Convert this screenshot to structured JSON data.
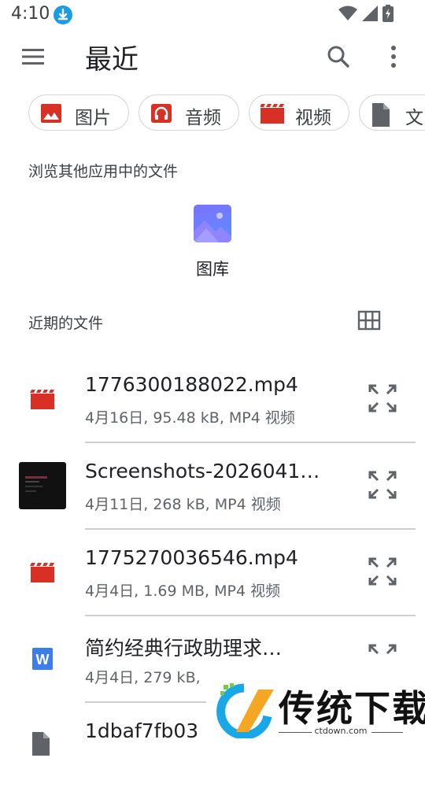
{
  "status_bar": {
    "time": "4:10",
    "icons": [
      "download-icon",
      "wifi-icon",
      "signal-icon",
      "battery-charging-icon"
    ]
  },
  "toolbar": {
    "title": "最近",
    "menu_icon": "hamburger-menu-icon",
    "search_icon": "search-icon",
    "more_icon": "more-vert-icon"
  },
  "chips": [
    {
      "label": "图片",
      "icon": "image-icon",
      "color": "#d93025"
    },
    {
      "label": "音频",
      "icon": "headphones-icon",
      "color": "#d93025"
    },
    {
      "label": "视频",
      "icon": "movie-clapper-icon",
      "color": "#d93025"
    },
    {
      "label": "文",
      "icon": "document-icon",
      "color": "#5f6368"
    }
  ],
  "browse_section": {
    "heading": "浏览其他应用中的文件",
    "apps": [
      {
        "label": "图库",
        "icon": "gallery-icon"
      }
    ]
  },
  "recent_section": {
    "heading": "近期的文件",
    "grid_icon": "grid-view-icon"
  },
  "files": [
    {
      "name": "1776300188022.mp4",
      "meta": "4月16日, 95.48 kB, MP4 视频",
      "icon": "movie-clapper-icon"
    },
    {
      "name": "Screenshots-2026041…",
      "meta": "4月11日, 268 kB, MP4 视频",
      "icon": "video-thumbnail"
    },
    {
      "name": "1775270036546.mp4",
      "meta": "4月4日, 1.69 MB, MP4 视频",
      "icon": "movie-clapper-icon"
    },
    {
      "name": "简约经典行政助理求…",
      "meta": "4月4日, 279 kB,",
      "icon": "word-doc-icon"
    },
    {
      "name": "1dbaf7fb03",
      "meta": "",
      "icon": "document-icon"
    }
  ],
  "watermark": {
    "text": "传统下载",
    "domain": "ctdown.com"
  },
  "colors": {
    "accent_red": "#d93025",
    "text_primary": "#202124",
    "text_secondary": "#5f6368",
    "word_blue": "#3b7ded",
    "gallery_purple": "#6f7cff"
  }
}
